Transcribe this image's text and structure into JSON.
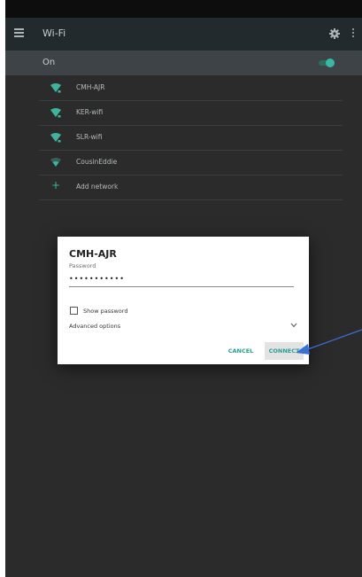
{
  "app_bar": {
    "title": "Wi-Fi",
    "menu_icon": "menu-icon",
    "settings_icon": "gear-icon",
    "overflow_icon": "more-vert-icon"
  },
  "master_switch": {
    "label": "On",
    "enabled": true
  },
  "networks": [
    {
      "name": "CMH-AJR",
      "icon": "wifi-locked-icon"
    },
    {
      "name": "KER-wifi",
      "icon": "wifi-locked-icon"
    },
    {
      "name": "SLR-wifi",
      "icon": "wifi-locked-icon"
    },
    {
      "name": "CousinEddie",
      "icon": "wifi-weak-icon"
    }
  ],
  "add_network": {
    "label": "Add network",
    "icon": "plus-icon"
  },
  "dialog": {
    "title": "CMH-AJR",
    "password_label": "Password",
    "password_value": "•••••••••••",
    "show_password_label": "Show password",
    "show_password_checked": false,
    "advanced_label": "Advanced options",
    "cancel_label": "CANCEL",
    "connect_label": "CONNECT"
  },
  "colors": {
    "accent": "#2a9d8f",
    "toggle_on": "#39b8a3",
    "wifi_icon": "#3fb39e",
    "app_bar": "#222a2e",
    "background": "#2b2b2b",
    "arrow": "#3a6fd8"
  }
}
